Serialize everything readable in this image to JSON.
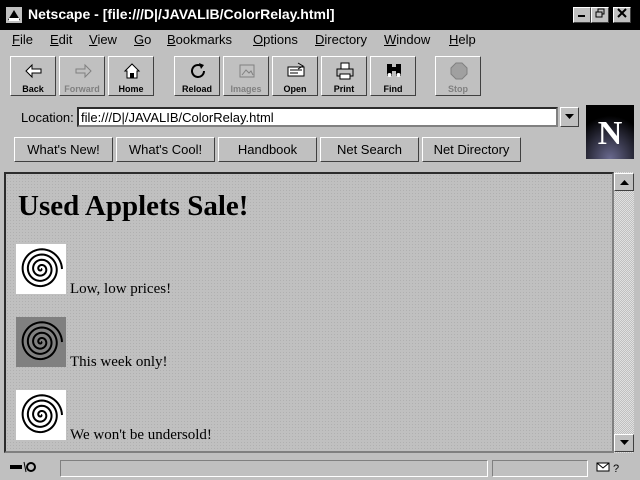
{
  "window": {
    "title": "Netscape - [file:///D|/JAVALIB/ColorRelay.html]"
  },
  "menu": [
    {
      "u": "F",
      "rest": "ile"
    },
    {
      "u": "E",
      "rest": "dit"
    },
    {
      "u": "V",
      "rest": "iew"
    },
    {
      "u": "G",
      "rest": "o"
    },
    {
      "u": "B",
      "rest": "ookmarks"
    },
    {
      "u": "O",
      "rest": "ptions"
    },
    {
      "u": "D",
      "rest": "irectory"
    },
    {
      "u": "W",
      "rest": "indow"
    },
    {
      "u": "H",
      "rest": "elp"
    }
  ],
  "toolbar": {
    "back": "Back",
    "forward": "Forward",
    "home": "Home",
    "reload": "Reload",
    "images": "Images",
    "open": "Open",
    "print": "Print",
    "find": "Find",
    "stop": "Stop"
  },
  "location": {
    "label": "Location:",
    "value": "file:///D|/JAVALIB/ColorRelay.html"
  },
  "directory_buttons": [
    "What's New!",
    "What's Cool!",
    "Handbook",
    "Net Search",
    "Net Directory"
  ],
  "content": {
    "heading": "Used Applets Sale!",
    "items": [
      {
        "text": "Low, low prices!",
        "image_bg": "#ffffff"
      },
      {
        "text": "This week only!",
        "image_bg": "#808080"
      },
      {
        "text": "We won't be undersold!",
        "image_bg": "#ffffff"
      }
    ]
  },
  "logo": {
    "letter": "N"
  }
}
